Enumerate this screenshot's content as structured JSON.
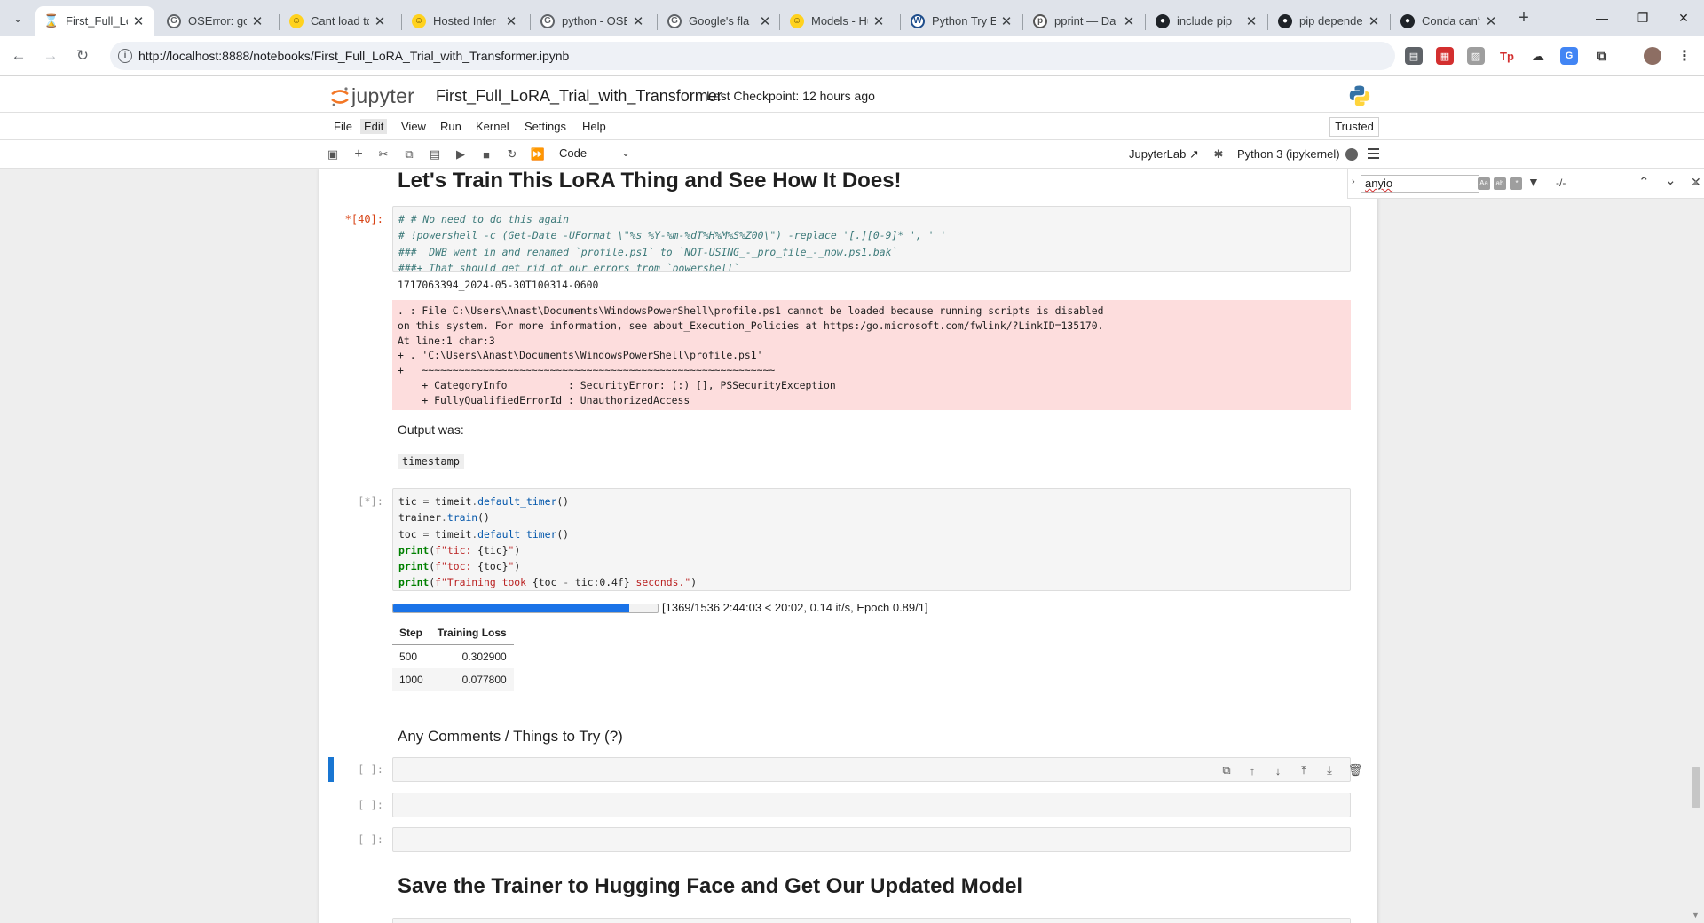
{
  "browser": {
    "tabs": [
      {
        "title": "First_Full_LoR",
        "active": true,
        "icon": "hourglass-icon"
      },
      {
        "title": "OSError: goo",
        "icon": "google-icon"
      },
      {
        "title": "Cant load to",
        "icon": "hf-icon"
      },
      {
        "title": "Hosted Infer",
        "icon": "hf-icon"
      },
      {
        "title": "python - OSE",
        "icon": "google-icon"
      },
      {
        "title": "Google's fla",
        "icon": "google-icon"
      },
      {
        "title": "Models - Hu",
        "icon": "hf-icon"
      },
      {
        "title": "Python Try E",
        "icon": "w-icon"
      },
      {
        "title": "pprint — Da",
        "icon": "python-icon"
      },
      {
        "title": "include pip",
        "icon": "github-icon"
      },
      {
        "title": "pip depende",
        "icon": "github-icon"
      },
      {
        "title": "Conda can't",
        "icon": "github-icon"
      }
    ],
    "url": "http://localhost:8888/notebooks/First_Full_LoRA_Trial_with_Transformer.ipynb"
  },
  "jupyter": {
    "logo_text": "jupyter",
    "notebook_title": "First_Full_LoRA_Trial_with_Transformer",
    "checkpoint": "Last Checkpoint: 12 hours ago",
    "menu": [
      "File",
      "Edit",
      "View",
      "Run",
      "Kernel",
      "Settings",
      "Help"
    ],
    "trusted": "Trusted",
    "cell_type": "Code",
    "jupyterlab_link": "JupyterLab",
    "kernel": "Python 3 (ipykernel)"
  },
  "search": {
    "query": "anyio",
    "match_count": "-/-"
  },
  "notebook": {
    "heading_train": "Let's Train This LoRA Thing and See How It Does!",
    "cell40": {
      "prompt": "*[40]:",
      "lines": [
        "# # No need to do this again",
        "# !powershell -c (Get-Date -UFormat \\\"%s_%Y-%m-%dT%H%M%S%Z00\\\") -replace '[.][0-9]*_', '_'",
        "###  DWB went in and renamed `profile.ps1` to `NOT-USING_-_pro_file_-_now.ps1.bak`",
        "###+ That should get rid of our errors from `powershell`"
      ],
      "stdout": "1717063394_2024-05-30T100314-0600",
      "stderr": [
        ". : File C:\\Users\\Anast\\Documents\\WindowsPowerShell\\profile.ps1 cannot be loaded because running scripts is disabled",
        "on this system. For more information, see about_Execution_Policies at https:/go.microsoft.com/fwlink/?LinkID=135170.",
        "At line:1 char:3",
        "+ . 'C:\\Users\\Anast\\Documents\\WindowsPowerShell\\profile.ps1'",
        "+   ~~~~~~~~~~~~~~~~~~~~~~~~~~~~~~~~~~~~~~~~~~~~~~~~~~~~~~~~~~",
        "    + CategoryInfo          : SecurityError: (:) [], PSSecurityException",
        "    + FullyQualifiedErrorId : UnauthorizedAccess"
      ]
    },
    "output_was": "Output was:",
    "timestamp_badge": "timestamp",
    "train_cell": {
      "prompt": "[*]:",
      "progress_fraction": 0.891,
      "progress_text": "[1369/1536 2:44:03 < 20:02, 0.14 it/s, Epoch 0.89/1]",
      "loss_headers": [
        "Step",
        "Training Loss"
      ],
      "loss_rows": [
        [
          "500",
          "0.302900"
        ],
        [
          "1000",
          "0.077800"
        ]
      ]
    },
    "heading_comments": "Any Comments / Things to Try (?)",
    "empty_prompt": "[ ]:",
    "heading_save": "Save the Trainer to Hugging Face and Get Our Updated Model"
  }
}
